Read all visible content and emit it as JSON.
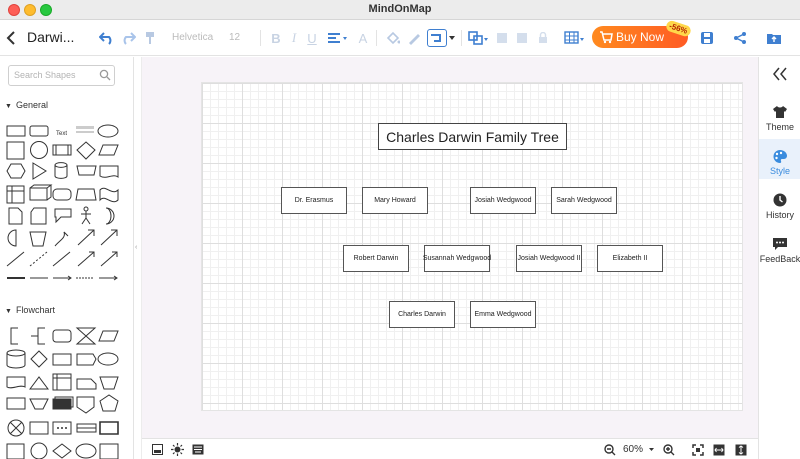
{
  "window": {
    "title": "MindOnMap"
  },
  "toolbar": {
    "doc_title": "Darwi...",
    "font_name": "Helvetica",
    "font_size": "12",
    "buy_label": "Buy Now",
    "discount_badge": "-56%"
  },
  "left_panel": {
    "search_placeholder": "Search Shapes",
    "sections": [
      {
        "label": "General"
      },
      {
        "label": "Flowchart"
      }
    ],
    "text_shape_label": "Text"
  },
  "diagram": {
    "title": "Charles Darwin Family Tree",
    "nodes": [
      "Dr. Erasmus",
      "Mary Howard",
      "Josiah Wedgwood",
      "Sarah Wedgwood",
      "Robert Darwin",
      "Susannah Wedgwood",
      "Josiah Wedgwood II",
      "Elizabeth II",
      "Charles Darwin",
      "Emma Wedgwood"
    ]
  },
  "statusbar": {
    "zoom": "60%"
  },
  "right_panel": {
    "items": [
      {
        "label": "Theme",
        "icon": "shirt-icon"
      },
      {
        "label": "Style",
        "icon": "palette-icon"
      },
      {
        "label": "History",
        "icon": "clock-icon"
      },
      {
        "label": "FeedBack",
        "icon": "feedback-icon"
      }
    ]
  },
  "colors": {
    "accent": "#3a8cde",
    "buy_start": "#ff8a1f",
    "buy_end": "#ff5b24",
    "toolbar_icon": "#3f7fd0"
  }
}
